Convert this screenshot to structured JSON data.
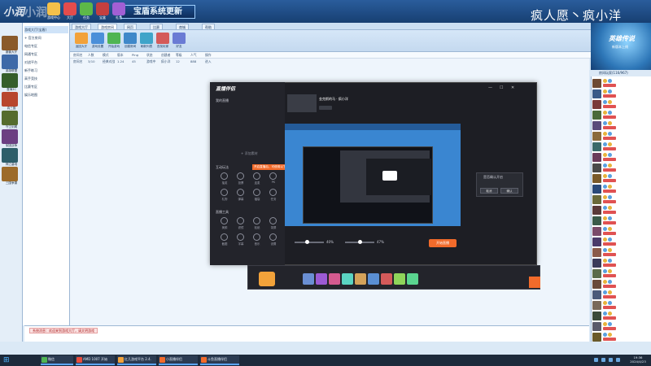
{
  "window": {
    "logo": "小润",
    "banner": "宝盾系统更新",
    "overlay": "疯人愿丶疯小洋"
  },
  "topicons": [
    {
      "label": "游戏中心",
      "color": "#f3c04a"
    },
    {
      "label": "大厅",
      "color": "#e44c4c"
    },
    {
      "label": "任务",
      "color": "#5db848"
    },
    {
      "label": "宝盒",
      "color": "#c43f3f"
    },
    {
      "label": "礼包",
      "color": "#a25fd4"
    }
  ],
  "leftgames": [
    {
      "label": "魔兽大厅",
      "color": "#8a5a2a"
    },
    {
      "label": "英雄联盟",
      "color": "#3e6aa8"
    },
    {
      "label": "澄海3C",
      "color": "#355e2a"
    },
    {
      "label": "真三国",
      "color": "#b8462e"
    },
    {
      "label": "守卫剑阁",
      "color": "#556c2e"
    },
    {
      "label": "军团战争",
      "color": "#6b3f82"
    },
    {
      "label": "神之墓地",
      "color": "#2d5e6a"
    },
    {
      "label": "三国争霸",
      "color": "#9c6b2a"
    }
  ],
  "tree": [
    {
      "text": "游戏大厅(宝盾)",
      "sel": true
    },
    {
      "text": "+ 官方房间",
      "sel": false
    },
    {
      "text": "  电信专区",
      "sel": false
    },
    {
      "text": "  网通专区",
      "sel": false
    },
    {
      "text": "  对战平台",
      "sel": false
    },
    {
      "text": "  新手练习",
      "sel": false
    },
    {
      "text": "  高手竞技",
      "sel": false
    },
    {
      "text": "  比赛专区",
      "sel": false
    },
    {
      "text": "  娱乐地图",
      "sel": false
    }
  ],
  "tabs": [
    "游戏大厅",
    "游戏房间",
    "网页",
    "比赛",
    "商城",
    "帮助"
  ],
  "toolbar": [
    {
      "label": "返回大厅",
      "color": "#f2a23a"
    },
    {
      "label": "游戏设置",
      "color": "#4a8fd9"
    },
    {
      "label": "开始游戏",
      "color": "#4fb553"
    },
    {
      "label": "创建房间",
      "color": "#3f88c9"
    },
    {
      "label": "刷新列表",
      "color": "#3fa4c9"
    },
    {
      "label": "查找玩家",
      "color": "#d45a5a"
    },
    {
      "label": "好友",
      "color": "#6a7bd4"
    }
  ],
  "roomhead": [
    "房间名",
    "人数",
    "模式",
    "版本",
    "Ping",
    "状态",
    "创建者",
    "等级",
    "人气",
    "操作"
  ],
  "roomrow": [
    "房间名",
    "3/10",
    "经典对战",
    "1.24",
    "45",
    "游戏中",
    "疯小洋",
    "12",
    "888",
    "进入"
  ],
  "ad": {
    "title": "英雄传说",
    "sub": "新版本上线"
  },
  "rlist": {
    "header": "房间玩家(116/967)"
  },
  "users": [
    {
      "av": "#6e4a32",
      "b1": "#e8b33b",
      "b2": "#5aa0e0"
    },
    {
      "av": "#3a5a88",
      "b1": "#e8b33b",
      "b2": "#5aa0e0"
    },
    {
      "av": "#7a3a3a",
      "b1": "#5aa0e0",
      "b2": "#e8b33b"
    },
    {
      "av": "#4a6a3a",
      "b1": "#e8b33b",
      "b2": "#5aa0e0"
    },
    {
      "av": "#5a4a7a",
      "b1": "#5aa0e0",
      "b2": "#e8b33b"
    },
    {
      "av": "#8a6a3a",
      "b1": "#e8b33b",
      "b2": "#5aa0e0"
    },
    {
      "av": "#3a6a6a",
      "b1": "#5aa0e0",
      "b2": "#e8b33b"
    },
    {
      "av": "#6a3a5a",
      "b1": "#e8b33b",
      "b2": "#5aa0e0"
    },
    {
      "av": "#4a4a4a",
      "b1": "#5aa0e0",
      "b2": "#e8b33b"
    },
    {
      "av": "#7a5a2a",
      "b1": "#e8b33b",
      "b2": "#5aa0e0"
    },
    {
      "av": "#2a4a7a",
      "b1": "#5aa0e0",
      "b2": "#e8b33b"
    },
    {
      "av": "#6a6a3a",
      "b1": "#e8b33b",
      "b2": "#5aa0e0"
    },
    {
      "av": "#5a3a3a",
      "b1": "#5aa0e0",
      "b2": "#e8b33b"
    },
    {
      "av": "#3a5a4a",
      "b1": "#e8b33b",
      "b2": "#5aa0e0"
    },
    {
      "av": "#7a4a6a",
      "b1": "#5aa0e0",
      "b2": "#e8b33b"
    },
    {
      "av": "#4a3a6a",
      "b1": "#e8b33b",
      "b2": "#5aa0e0"
    },
    {
      "av": "#8a5a4a",
      "b1": "#5aa0e0",
      "b2": "#e8b33b"
    },
    {
      "av": "#3a3a5a",
      "b1": "#e8b33b",
      "b2": "#5aa0e0"
    },
    {
      "av": "#5a6a4a",
      "b1": "#5aa0e0",
      "b2": "#e8b33b"
    },
    {
      "av": "#6a4a3a",
      "b1": "#e8b33b",
      "b2": "#5aa0e0"
    },
    {
      "av": "#4a5a7a",
      "b1": "#5aa0e0",
      "b2": "#e8b33b"
    },
    {
      "av": "#7a6a5a",
      "b1": "#e8b33b",
      "b2": "#5aa0e0"
    },
    {
      "av": "#3a4a3a",
      "b1": "#5aa0e0",
      "b2": "#e8b33b"
    },
    {
      "av": "#5a5a6a",
      "b1": "#e8b33b",
      "b2": "#5aa0e0"
    },
    {
      "av": "#6a5a2a",
      "b1": "#5aa0e0",
      "b2": "#e8b33b"
    }
  ],
  "chat": {
    "message": "系统消息：欢迎来到游戏大厅，请文明游戏"
  },
  "streamer": {
    "app_name": "直播伴侣",
    "scene": "我的直播",
    "add_scene": "+ 添加素材",
    "section_interact": "互动玩法",
    "section_tools": "直播工具",
    "notice": "开启直播后，可使用以下功能",
    "room_title": "金克斯的马 · 疯小洋",
    "start_label": "开始直播",
    "volume1": "40%",
    "volume2": "47%",
    "dialog_text": "是否确认开启",
    "dialog_ok": "确认",
    "dialog_cancel": "取消",
    "interact": [
      "抽奖",
      "投票",
      "连麦",
      "PK",
      "礼物",
      "弹幕",
      "福袋",
      "任务"
    ],
    "tools": [
      "美颜",
      "滤镜",
      "贴纸",
      "录屏",
      "截图",
      "字幕",
      "音乐",
      "设置"
    ]
  },
  "taskbar": {
    "items": [
      {
        "label": "微信",
        "color": "#4fb553"
      },
      {
        "label": "AMD 1007 开始",
        "color": "#e84c3d"
      },
      {
        "label": "红几游戏平台 2.4.",
        "color": "#f2a23a"
      },
      {
        "label": "小直播伴侣",
        "color": "#f26b2b"
      },
      {
        "label": "斗鱼直播伴侣",
        "color": "#f26b2b"
      }
    ],
    "time": "19:36",
    "date": "2024/4/23"
  }
}
